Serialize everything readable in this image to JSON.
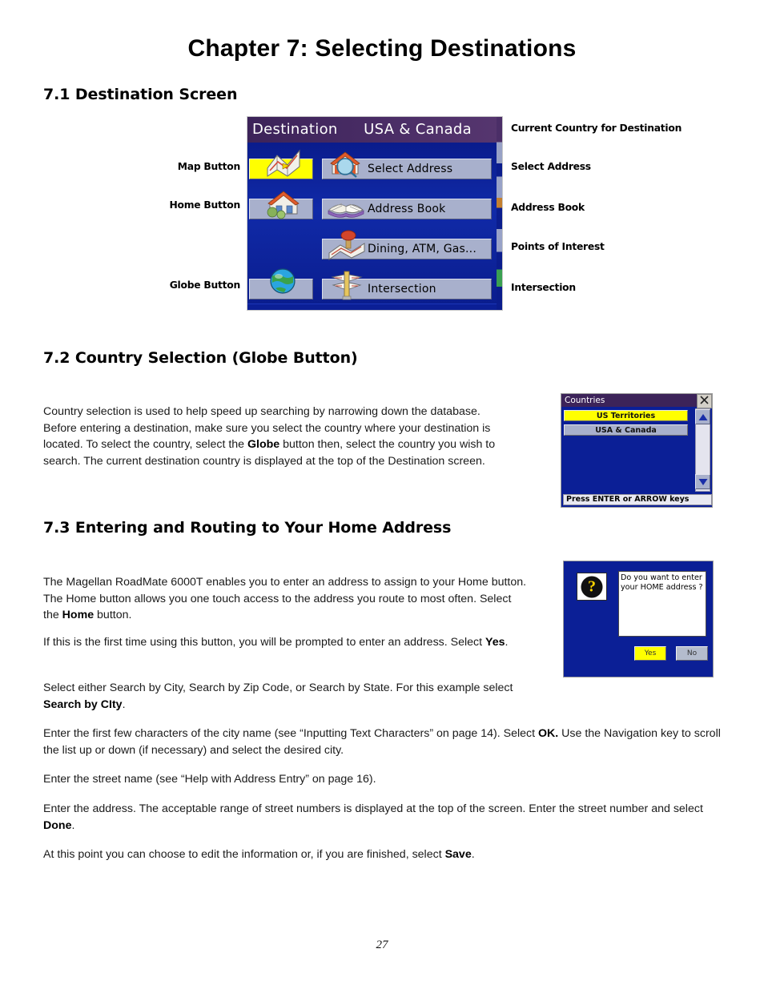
{
  "document": {
    "chapter_title": "Chapter 7: Selecting Destinations",
    "page_number": "27"
  },
  "section_71": {
    "heading": "7.1 Destination Screen",
    "callouts_left": [
      {
        "label": "Map Button"
      },
      {
        "label": "Home Button"
      },
      {
        "label": "Globe Button"
      }
    ],
    "callouts_right": [
      {
        "label": "Current Country for Destination"
      },
      {
        "label": "Select Address"
      },
      {
        "label": "Address Book"
      },
      {
        "label": "Points of Interest"
      },
      {
        "label": "Intersection"
      }
    ],
    "destination_screen": {
      "title": "Destination",
      "country": "USA & Canada",
      "side_buttons": [
        {
          "name": "map-button",
          "icon": "map-icon",
          "highlighted": true
        },
        {
          "name": "home-button",
          "icon": "house-icon",
          "highlighted": false
        },
        {
          "name": "globe-button",
          "icon": "globe-icon",
          "highlighted": false
        }
      ],
      "menu_items": [
        {
          "label": "Select Address",
          "icon": "house-magnifier-icon"
        },
        {
          "label": "Address Book",
          "icon": "open-book-icon"
        },
        {
          "label": "Dining, ATM, Gas...",
          "icon": "map-pin-icon"
        },
        {
          "label": "Intersection",
          "icon": "crossroads-sign-icon"
        }
      ]
    }
  },
  "section_72": {
    "heading": "7.2 Country Selection (Globe Button)",
    "paragraph_parts": [
      "Country selection is used to help speed up searching by narrowing down the database. Before entering a destination, make sure you select the country where your destination is located. To select the country, select the ",
      "Globe",
      " button then, select the country you wish to search. The current destination country is displayed at the top of the Destination screen."
    ],
    "countries_dialog": {
      "title": "Countries",
      "close_icon": "close-icon",
      "items": [
        {
          "label": "US Territories",
          "selected": true
        },
        {
          "label": "USA & Canada",
          "selected": false
        }
      ],
      "scroll_up_icon": "triangle-up-icon",
      "scroll_down_icon": "triangle-down-icon",
      "status": "Press ENTER or ARROW keys"
    }
  },
  "section_73": {
    "heading": "7.3 Entering and Routing to Your Home Address",
    "paragraphs": [
      {
        "parts": [
          "The Magellan RoadMate 6000T enables you to enter an address to assign to your Home button. The Home button allows you one touch access to the address you route to most often. Select the ",
          "Home",
          " button."
        ]
      },
      {
        "parts": [
          "If this is the first time using this button, you will be prompted to enter an address. Select ",
          "Yes",
          "."
        ]
      },
      {
        "parts": [
          "Select either Search by City, Search by Zip Code, or Search by State. For this example select ",
          "Search by CIty",
          "."
        ]
      },
      {
        "parts": [
          "Enter the first few characters of the city name (see “Inputting Text Characters” on page 14). Select ",
          "OK.",
          " Use the Navigation key to scroll the list up or down (if necessary) and select the desired city."
        ]
      },
      {
        "parts": [
          "Enter the street name (see “Help with Address Entry” on page 16).",
          "",
          ""
        ]
      },
      {
        "parts": [
          "Enter the address. The acceptable range of street numbers is displayed at the top of the screen. Enter the street number and select ",
          "Done",
          "."
        ]
      },
      {
        "parts": [
          "At this point you can choose to edit the information or, if you are finished, select ",
          "Save",
          "."
        ]
      }
    ],
    "home_dialog": {
      "question_icon": "question-mark-icon",
      "message": "Do you want to enter your HOME address ?",
      "yes_label": "Yes",
      "no_label": "No"
    }
  },
  "colors": {
    "device_blue": "#0b1f96",
    "titlebar_purple": "#3c2359",
    "highlight_yellow": "#ffff00",
    "button_grey": "#a8b0cc"
  }
}
